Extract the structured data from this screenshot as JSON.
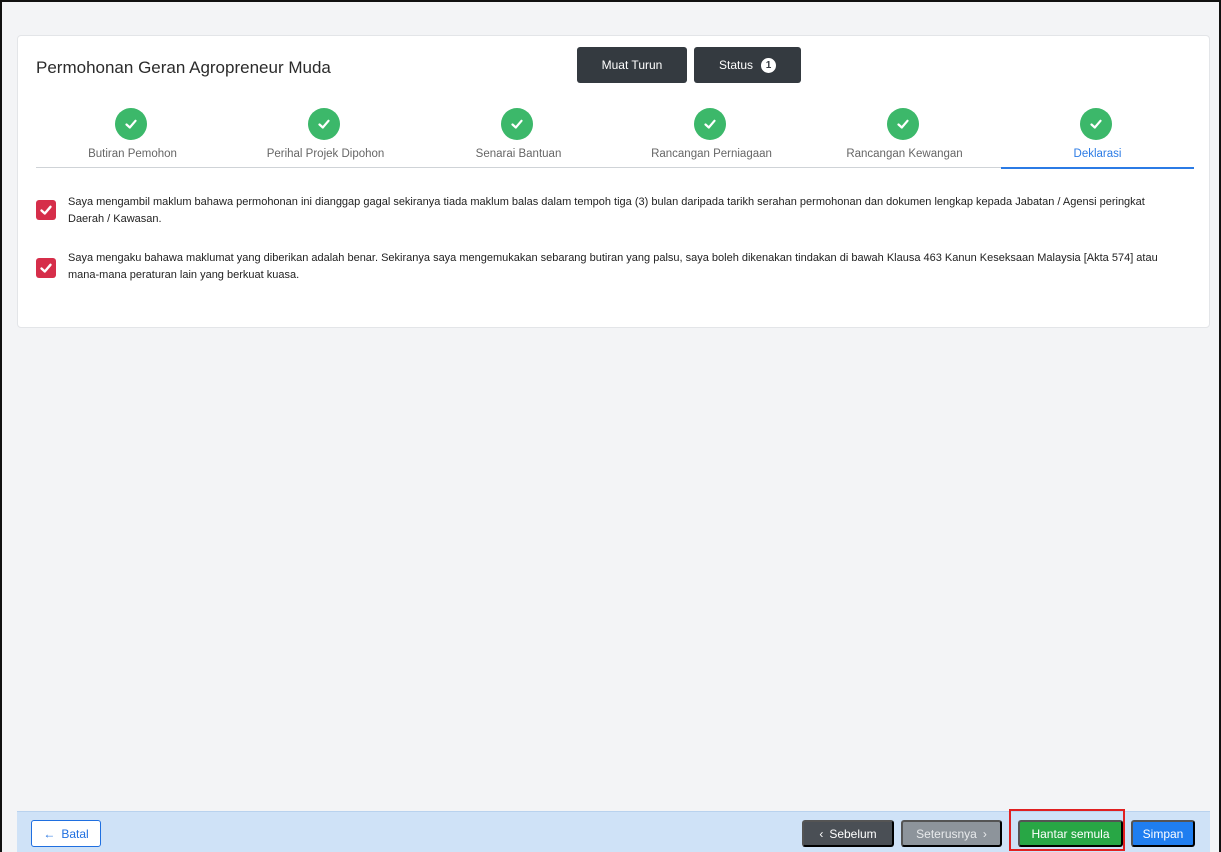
{
  "header": {
    "title": "Permohonan Geran Agropreneur Muda",
    "download_label": "Muat Turun",
    "status_label": "Status",
    "status_count": "1"
  },
  "steps": [
    {
      "label": "Butiran Pemohon",
      "state": "done"
    },
    {
      "label": "Perihal Projek Dipohon",
      "state": "done"
    },
    {
      "label": "Senarai Bantuan",
      "state": "done"
    },
    {
      "label": "Rancangan Perniagaan",
      "state": "done"
    },
    {
      "label": "Rancangan Kewangan",
      "state": "done"
    },
    {
      "label": "Deklarasi",
      "state": "active"
    }
  ],
  "declarations": [
    {
      "checked": true,
      "text": "Saya mengambil maklum bahawa permohonan ini dianggap gagal sekiranya tiada maklum balas dalam tempoh tiga (3) bulan daripada tarikh serahan permohonan dan dokumen lengkap kepada Jabatan / Agensi peringkat Daerah / Kawasan."
    },
    {
      "checked": true,
      "text": "Saya mengaku bahawa maklumat yang diberikan adalah benar. Sekiranya saya mengemukakan sebarang butiran yang palsu, saya boleh dikenakan tindakan di bawah Klausa 463 Kanun Keseksaan Malaysia [Akta 574] atau mana-mana peraturan lain yang berkuat kuasa."
    }
  ],
  "footer": {
    "cancel_label": "Batal",
    "prev_label": "Sebelum",
    "next_label": "Seterusnya",
    "resubmit_label": "Hantar semula",
    "save_label": "Simpan"
  },
  "colors": {
    "step_done": "#3cb86a",
    "step_active": "#2b7be5",
    "checkbox": "#d62e4a",
    "resubmit": "#28a745",
    "save": "#1f7ef0",
    "highlight": "#e02020"
  }
}
